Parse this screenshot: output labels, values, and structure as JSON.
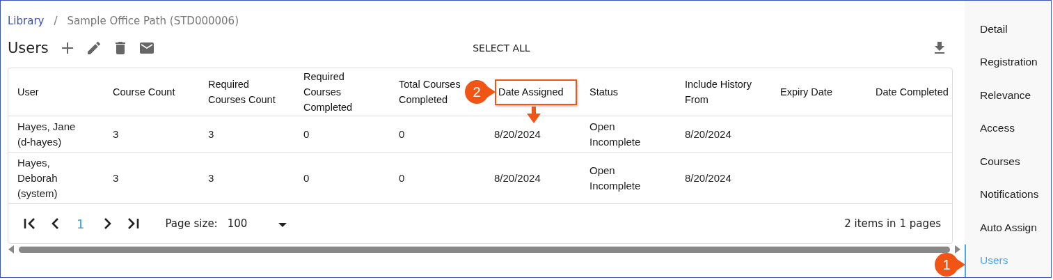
{
  "breadcrumb": [
    {
      "label": "Library",
      "kind": "link"
    },
    {
      "label": "/",
      "kind": "separator"
    },
    {
      "label": "Sample Office Path (STD000006)",
      "kind": "current"
    }
  ],
  "toolbar": {
    "title": "Users",
    "select_all": "SELECT ALL"
  },
  "table": {
    "columns": [
      "User",
      "Course Count",
      "Required Courses Count",
      "Required Courses Completed",
      "Total Courses Completed",
      "Date Assigned",
      "Status",
      "Include History From",
      "Expiry Date",
      "Date Completed"
    ],
    "rows": [
      [
        "Hayes, Jane (d-hayes)",
        "3",
        "3",
        "0",
        "0",
        "8/20/2024",
        "Open Incomplete",
        "8/20/2024",
        "",
        ""
      ],
      [
        "Hayes, Deborah (system)",
        "3",
        "3",
        "0",
        "0",
        "8/20/2024",
        "Open Incomplete",
        "8/20/2024",
        "",
        ""
      ]
    ]
  },
  "pager": {
    "current_page": "1",
    "page_size_label": "Page size:",
    "page_size": "100",
    "summary": "2 items in 1 pages"
  },
  "sidebar": {
    "items": [
      {
        "label": "Detail",
        "selected": false
      },
      {
        "label": "Registration",
        "selected": false
      },
      {
        "label": "Relevance",
        "selected": false
      },
      {
        "label": "Access",
        "selected": false
      },
      {
        "label": "Courses",
        "selected": false
      },
      {
        "label": "Notifications",
        "selected": false
      },
      {
        "label": "Auto Assign",
        "selected": false
      },
      {
        "label": "Users",
        "selected": true
      }
    ]
  },
  "callouts": [
    {
      "label": "2"
    },
    {
      "label": "1"
    }
  ]
}
